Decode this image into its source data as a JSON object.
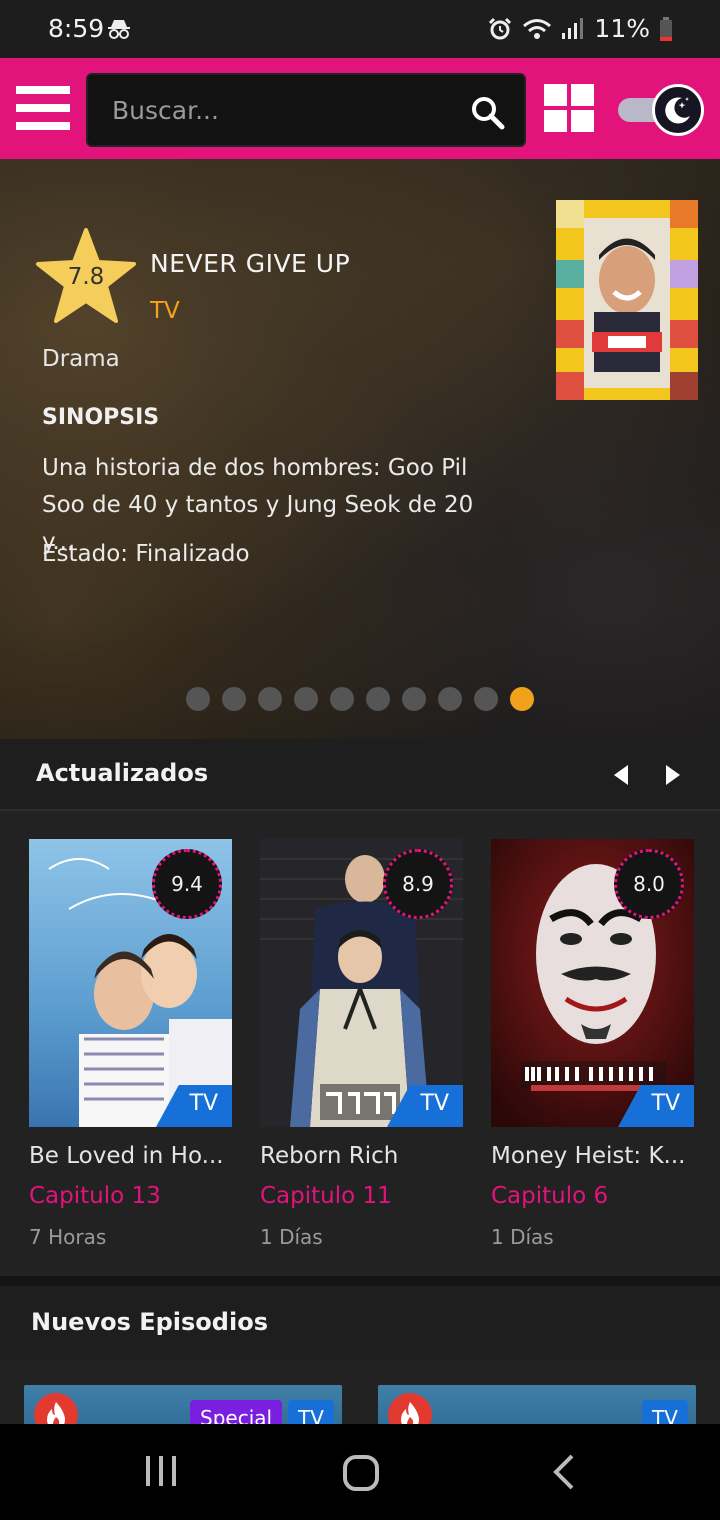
{
  "status_bar": {
    "time": "8:59",
    "battery": "11%"
  },
  "header": {
    "search_placeholder": "Buscar..."
  },
  "hero": {
    "score": "7.8",
    "title": "NEVER GIVE UP",
    "type": "TV",
    "genre": "Drama",
    "synopsis_heading": "SINOPSIS",
    "synopsis": "Una historia de dos hombres: Goo Pil Soo de 40 y tantos y Jung Seok de 20 y...",
    "status": "Estado: Finalizado",
    "dots_total": 10,
    "dots_active_index": 9
  },
  "updated": {
    "title": "Actualizados",
    "items": [
      {
        "title": "Be Loved in Ho...",
        "rating": "9.4",
        "type": "TV",
        "episode": "Capitulo 13",
        "time": "7 Horas"
      },
      {
        "title": "Reborn Rich",
        "rating": "8.9",
        "type": "TV",
        "episode": "Capitulo 11",
        "time": "1 Días"
      },
      {
        "title": "Money Heist: K...",
        "rating": "8.0",
        "type": "TV",
        "episode": "Capitulo 6",
        "time": "1 Días"
      }
    ]
  },
  "new_episodes": {
    "title": "Nuevos Episodios",
    "items": [
      {
        "badge": "Special",
        "type": "TV"
      },
      {
        "type": "TV"
      }
    ]
  },
  "colors": {
    "accent": "#e2137a",
    "star": "#f5cd5a",
    "active_dot": "#f0a21a",
    "tv_badge": "#1770d8",
    "special_badge": "#7a1fe0"
  },
  "icons": [
    "incognito-icon",
    "alarm-icon",
    "wifi-icon",
    "signal-icon",
    "battery-icon",
    "menu-icon",
    "search-icon",
    "grid-icon",
    "moon-icon",
    "arrow-left-icon",
    "arrow-right-icon",
    "fire-icon",
    "recents-icon",
    "home-icon",
    "back-icon"
  ]
}
